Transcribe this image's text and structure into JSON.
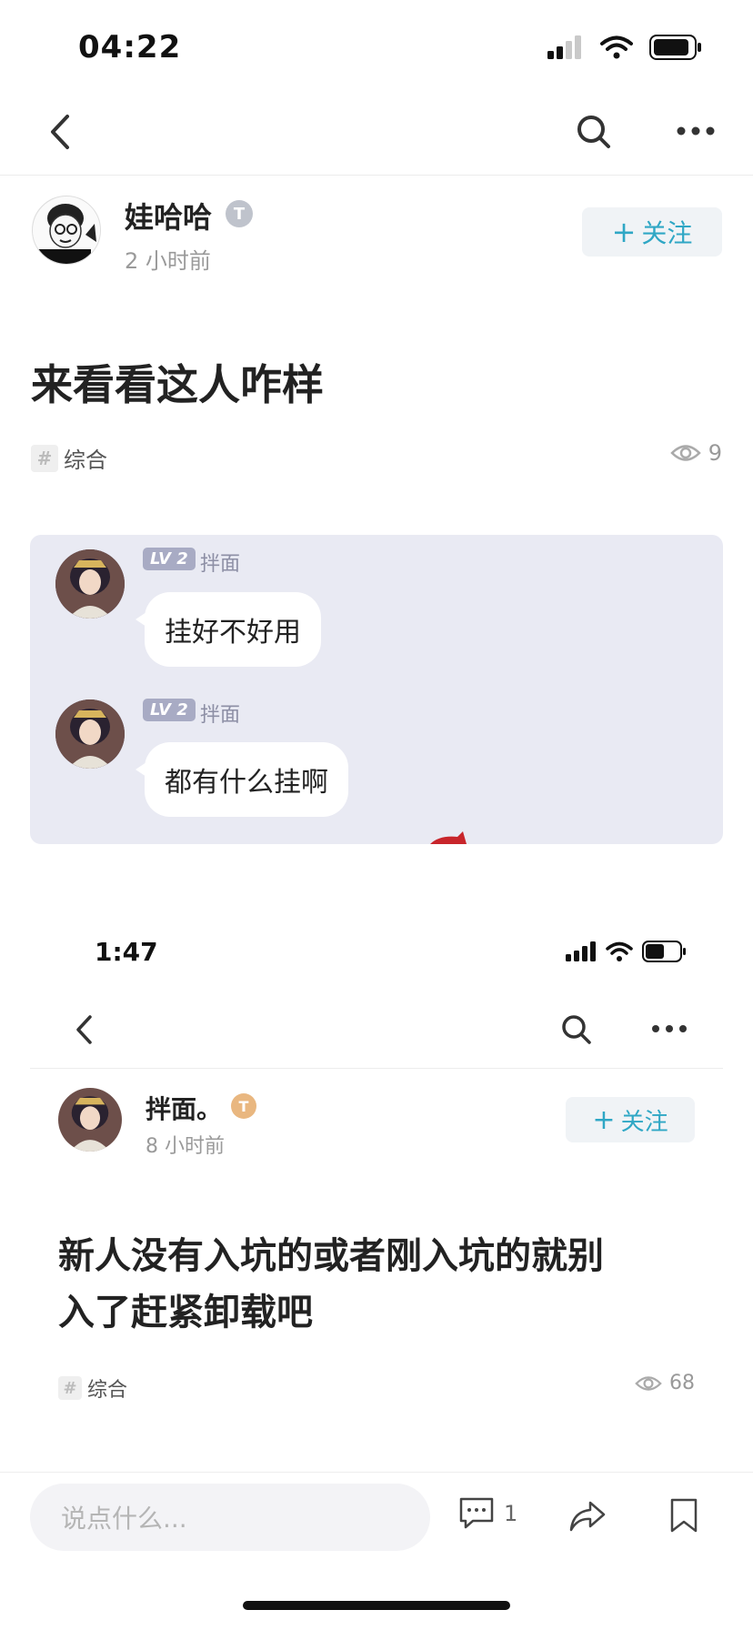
{
  "status_bar_1": {
    "time": "04:22"
  },
  "post_1": {
    "author": "娃哈哈",
    "badge": "T",
    "time_ago": "2 小时前",
    "follow_label": "关注",
    "title": "来看看这人咋样",
    "tag": "综合",
    "views": "9",
    "messages": [
      {
        "level": "LV 2",
        "name": "拌面",
        "text": "挂好不好用"
      },
      {
        "level": "LV 2",
        "name": "拌面",
        "text": "都有什么挂啊"
      }
    ]
  },
  "status_bar_2": {
    "time": "1:47"
  },
  "post_2": {
    "author": "拌面。",
    "badge": "T",
    "time_ago": "8 小时前",
    "follow_label": "关注",
    "title_line1": "新人没有入坑的或者刚入坑的就别",
    "title_line2": "入了赶紧卸载吧",
    "tag": "综合",
    "views": "68"
  },
  "bottom_bar": {
    "comment_placeholder": "说点什么...",
    "comment_count": "1"
  },
  "colors": {
    "accent": "#2fa7c5",
    "chat_bg": "#e9eaf3"
  }
}
